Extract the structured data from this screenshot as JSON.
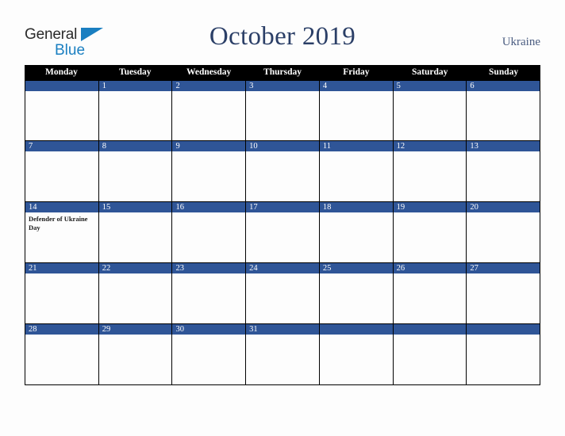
{
  "logo": {
    "word_one": "General",
    "word_two": "Blue",
    "triangle_icon": "triangle-icon",
    "color_dark": "#2b2b2b",
    "color_blue": "#1a7fc1"
  },
  "header": {
    "title": "October 2019",
    "country": "Ukraine",
    "title_color": "#2b3f67",
    "country_color": "#4a5c80"
  },
  "calendar": {
    "weekdays": [
      "Monday",
      "Tuesday",
      "Wednesday",
      "Thursday",
      "Friday",
      "Saturday",
      "Sunday"
    ],
    "header_bg": "#000000",
    "header_text_color": "#ffffff",
    "day_band_color": "#2f5597",
    "day_number_color": "#ffffff",
    "cell_bg": "#fdfdfd",
    "border_color": "#000000",
    "weeks": [
      [
        {
          "number": "",
          "events": []
        },
        {
          "number": "1",
          "events": []
        },
        {
          "number": "2",
          "events": []
        },
        {
          "number": "3",
          "events": []
        },
        {
          "number": "4",
          "events": []
        },
        {
          "number": "5",
          "events": []
        },
        {
          "number": "6",
          "events": []
        }
      ],
      [
        {
          "number": "7",
          "events": []
        },
        {
          "number": "8",
          "events": []
        },
        {
          "number": "9",
          "events": []
        },
        {
          "number": "10",
          "events": []
        },
        {
          "number": "11",
          "events": []
        },
        {
          "number": "12",
          "events": []
        },
        {
          "number": "13",
          "events": []
        }
      ],
      [
        {
          "number": "14",
          "events": [
            "Defender of Ukraine Day"
          ]
        },
        {
          "number": "15",
          "events": []
        },
        {
          "number": "16",
          "events": []
        },
        {
          "number": "17",
          "events": []
        },
        {
          "number": "18",
          "events": []
        },
        {
          "number": "19",
          "events": []
        },
        {
          "number": "20",
          "events": []
        }
      ],
      [
        {
          "number": "21",
          "events": []
        },
        {
          "number": "22",
          "events": []
        },
        {
          "number": "23",
          "events": []
        },
        {
          "number": "24",
          "events": []
        },
        {
          "number": "25",
          "events": []
        },
        {
          "number": "26",
          "events": []
        },
        {
          "number": "27",
          "events": []
        }
      ],
      [
        {
          "number": "28",
          "events": []
        },
        {
          "number": "29",
          "events": []
        },
        {
          "number": "30",
          "events": []
        },
        {
          "number": "31",
          "events": []
        },
        {
          "number": "",
          "events": []
        },
        {
          "number": "",
          "events": []
        },
        {
          "number": "",
          "events": []
        }
      ]
    ]
  }
}
